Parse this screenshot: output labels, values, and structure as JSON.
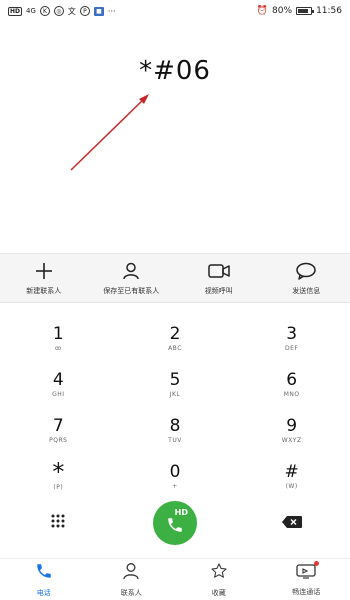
{
  "status": {
    "badges": [
      "HD",
      "4G",
      "K"
    ],
    "battery_text": "80%",
    "battery_level": 0.8,
    "time": "11:56"
  },
  "dialer": {
    "input_value": "*#06"
  },
  "actions": [
    {
      "icon": "plus-icon",
      "label": "新建联系人"
    },
    {
      "icon": "person-icon",
      "label": "保存至已有联系人"
    },
    {
      "icon": "video-icon",
      "label": "视频呼叫"
    },
    {
      "icon": "message-icon",
      "label": "发送信息"
    }
  ],
  "keys": [
    {
      "digit": "1",
      "sub": "ꝏ"
    },
    {
      "digit": "2",
      "sub": "ABC"
    },
    {
      "digit": "3",
      "sub": "DEF"
    },
    {
      "digit": "4",
      "sub": "GHI"
    },
    {
      "digit": "5",
      "sub": "JKL"
    },
    {
      "digit": "6",
      "sub": "MNO"
    },
    {
      "digit": "7",
      "sub": "PQRS"
    },
    {
      "digit": "8",
      "sub": "TUV"
    },
    {
      "digit": "9",
      "sub": "WXYZ"
    },
    {
      "digit": "*",
      "sub": "(P)"
    },
    {
      "digit": "0",
      "sub": "+"
    },
    {
      "digit": "#",
      "sub": "(W)"
    }
  ],
  "call_button": {
    "badge": "HD"
  },
  "tabs": [
    {
      "icon": "phone-icon",
      "label": "电话",
      "active": true
    },
    {
      "icon": "contacts-icon",
      "label": "联系人",
      "active": false
    },
    {
      "icon": "star-icon",
      "label": "收藏",
      "active": false
    },
    {
      "icon": "smart-screen-icon",
      "label": "畅连通话",
      "active": false
    }
  ],
  "colors": {
    "accent": "#1a73e8",
    "call_green": "#3cb043",
    "annotation_red": "#c62828"
  }
}
